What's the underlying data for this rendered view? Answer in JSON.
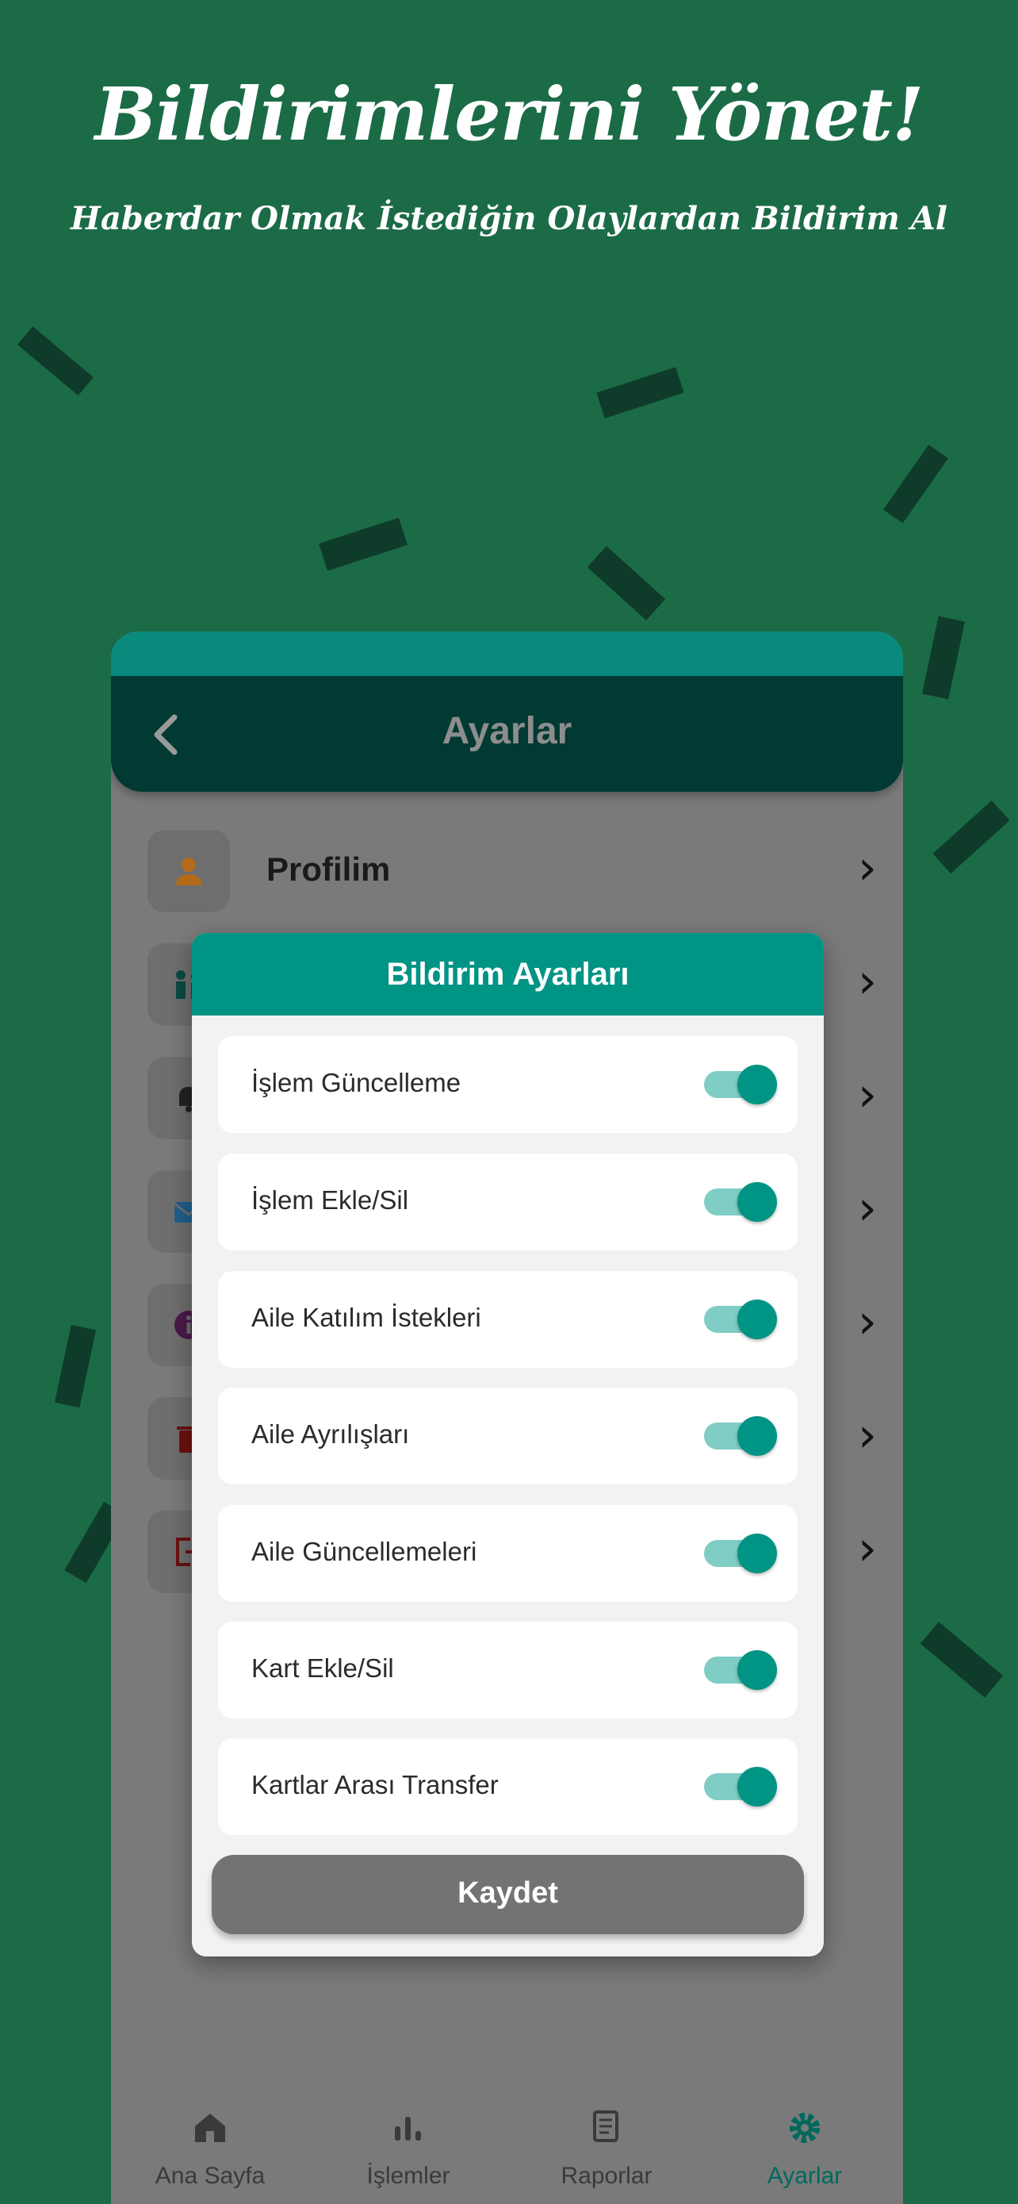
{
  "banner": {
    "title": "Bildirimlerini Yönet!",
    "subtitle": "Haberdar Olmak İstediğin Olaylardan Bildirim Al"
  },
  "header": {
    "title": "Ayarlar",
    "back_icon": "chevron-left-icon"
  },
  "settings_list": [
    {
      "label": "Profilim",
      "icon": "person-icon",
      "icon_color": "#b36b1a"
    },
    {
      "label": "",
      "icon": "family-icon",
      "icon_color": "#0b4a44"
    },
    {
      "label": "",
      "icon": "bell-icon",
      "icon_color": "#222222"
    },
    {
      "label": "",
      "icon": "mail-icon",
      "icon_color": "#1f5f8b"
    },
    {
      "label": "",
      "icon": "info-icon",
      "icon_color": "#4a1a4a"
    },
    {
      "label": "",
      "icon": "trash-icon",
      "icon_color": "#6b1010"
    },
    {
      "label": "",
      "icon": "logout-icon",
      "icon_color": "#6b1010"
    }
  ],
  "modal": {
    "title": "Bildirim Ayarları",
    "toggles": [
      {
        "label": "İşlem Güncelleme",
        "on": true
      },
      {
        "label": "İşlem Ekle/Sil",
        "on": true
      },
      {
        "label": "Aile Katılım İstekleri",
        "on": true
      },
      {
        "label": "Aile Ayrılışları",
        "on": true
      },
      {
        "label": "Aile Güncellemeleri",
        "on": true
      },
      {
        "label": "Kart Ekle/Sil",
        "on": true
      },
      {
        "label": "Kartlar Arası Transfer",
        "on": true
      }
    ],
    "save_label": "Kaydet"
  },
  "bottom_nav": [
    {
      "label": "Ana Sayfa",
      "icon": "home-icon",
      "active": false
    },
    {
      "label": "İşlemler",
      "icon": "bar-chart-icon",
      "active": false
    },
    {
      "label": "Raporlar",
      "icon": "receipt-icon",
      "active": false
    },
    {
      "label": "Ayarlar",
      "icon": "gear-icon",
      "active": true
    }
  ],
  "colors": {
    "background": "#1b6b47",
    "accent": "#009485",
    "header": "#003a33"
  }
}
